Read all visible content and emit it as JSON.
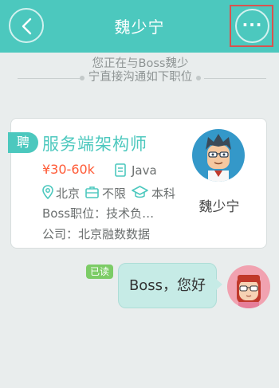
{
  "header": {
    "title": "魏少宁",
    "back_icon": "chevron-left-icon",
    "more_label": "···",
    "bg_color": "#4cc8be"
  },
  "notice": {
    "text": "您正在与Boss魏少宁直接沟通如下职位"
  },
  "job_card": {
    "tag": "聘",
    "title": "服务端架构师",
    "salary": "¥30-60k",
    "category": "Java",
    "city": "北京",
    "experience": "不限",
    "education": "本科",
    "boss_position": "Boss职位：技术负…",
    "company": "公司：北京融数数据",
    "boss_name": "魏少宁",
    "accent_color": "#4cc8be",
    "salary_color": "#ff5a36"
  },
  "message": {
    "read_status": "已读",
    "text": "Boss，您好"
  }
}
